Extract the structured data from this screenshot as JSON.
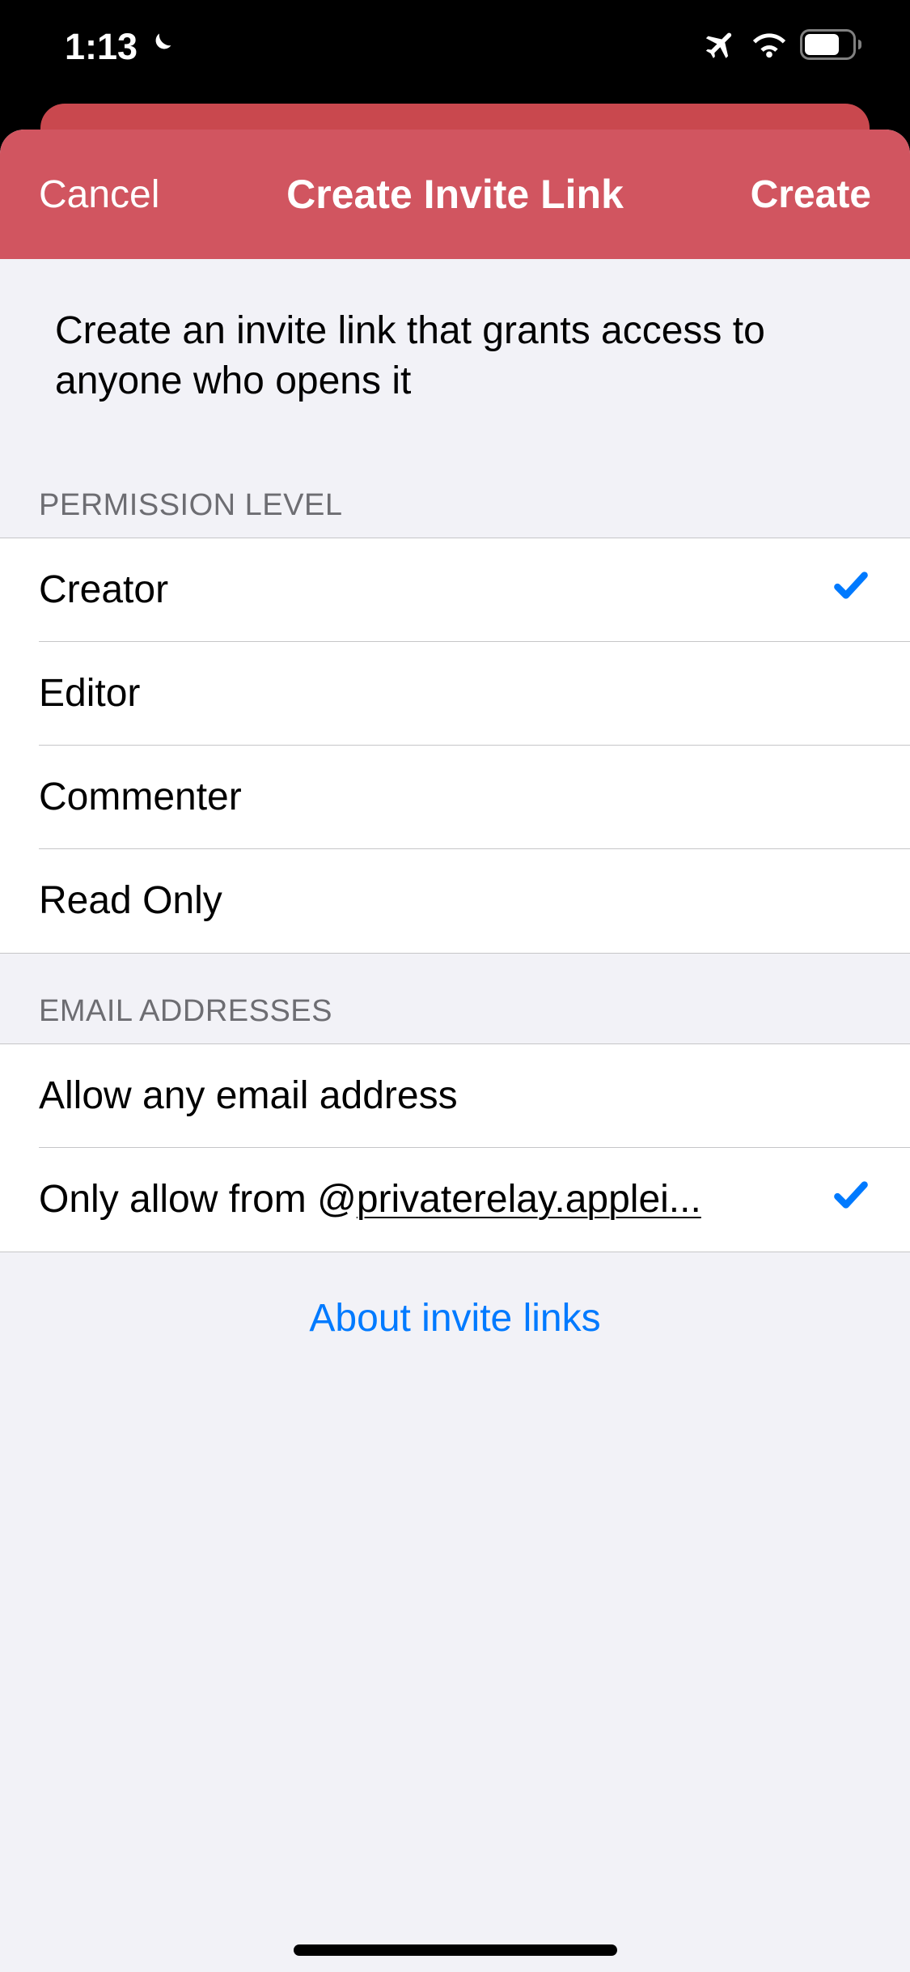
{
  "status_bar": {
    "time": "1:13"
  },
  "nav": {
    "cancel": "Cancel",
    "title": "Create Invite Link",
    "create": "Create"
  },
  "description": "Create an invite link that grants access to anyone who opens it",
  "sections": {
    "permission": {
      "header": "PERMISSION LEVEL",
      "options": [
        {
          "label": "Creator",
          "selected": true
        },
        {
          "label": "Editor",
          "selected": false
        },
        {
          "label": "Commenter",
          "selected": false
        },
        {
          "label": "Read Only",
          "selected": false
        }
      ]
    },
    "email": {
      "header": "EMAIL ADDRESSES",
      "options": [
        {
          "label_prefix": "Allow any email address",
          "label_underline": "",
          "selected": false
        },
        {
          "label_prefix": "Only allow from @",
          "label_underline": "privaterelay.applei...",
          "selected": true
        }
      ]
    }
  },
  "about_link": "About invite links",
  "colors": {
    "accent_red": "#d15560",
    "link_blue": "#007aff",
    "check_blue": "#007aff"
  }
}
